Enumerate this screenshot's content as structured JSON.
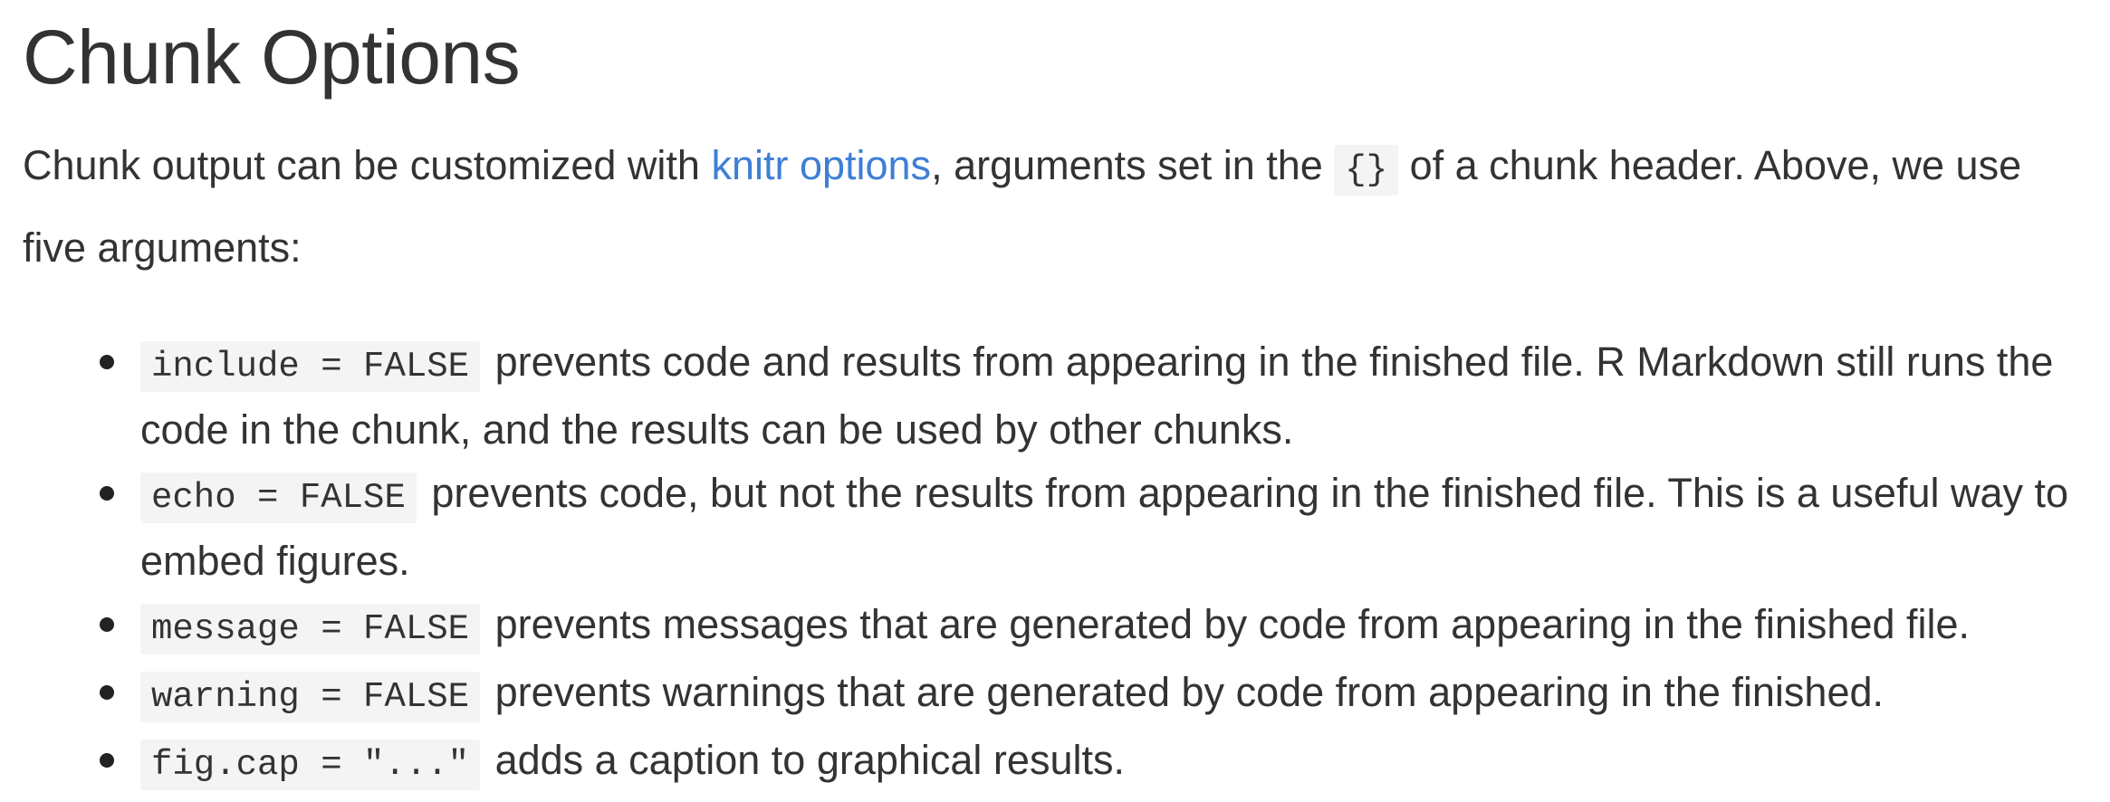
{
  "heading": "Chunk Options",
  "intro": {
    "part1": "Chunk output can be customized with ",
    "link_text": "knitr options",
    "part2": ", arguments set in the ",
    "code": "{}",
    "part3": " of a chunk header. Above, we use five arguments:"
  },
  "options": [
    {
      "code": "include = FALSE",
      "text": " prevents code and results from appearing in the finished file. R Markdown still runs the code in the chunk, and the results can be used by other chunks."
    },
    {
      "code": "echo = FALSE",
      "text": " prevents code, but not the results from appearing in the finished file. This is a useful way to embed figures."
    },
    {
      "code": "message = FALSE",
      "text": " prevents messages that are generated by code from appearing in the finished file."
    },
    {
      "code": "warning = FALSE",
      "text": " prevents warnings that are generated by code from appearing in the finished."
    },
    {
      "code": "fig.cap = \"...\"",
      "text": " adds a caption to graphical results."
    }
  ],
  "colors": {
    "link": "#3d7fd6",
    "text": "#333333",
    "code_bg": "#f4f4f4"
  }
}
